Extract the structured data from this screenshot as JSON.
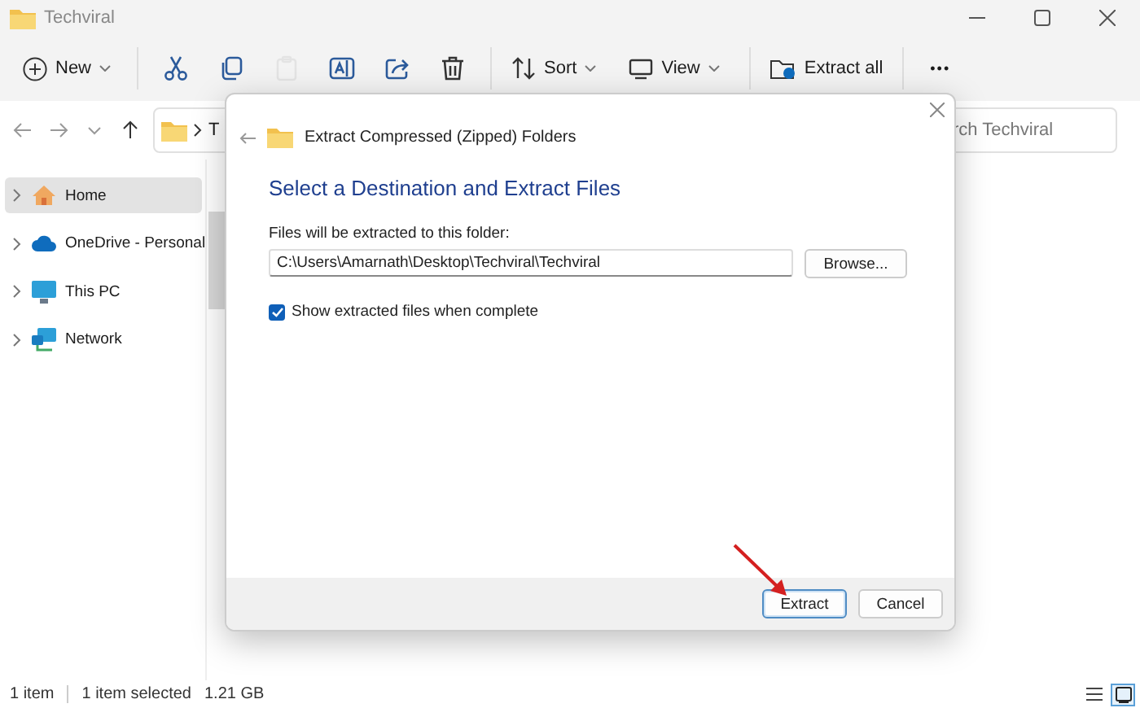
{
  "window": {
    "title": "Techviral"
  },
  "toolbar": {
    "new": "New",
    "icon_buttons": [
      {
        "kind": "cut",
        "disabled": false
      },
      {
        "kind": "copy",
        "disabled": false
      },
      {
        "kind": "paste",
        "disabled": true
      },
      {
        "kind": "rename",
        "disabled": false
      },
      {
        "kind": "share",
        "disabled": false
      },
      {
        "kind": "delete",
        "disabled": false
      }
    ],
    "sort": "Sort",
    "view": "View",
    "extract_all": "Extract all",
    "more": "•••"
  },
  "address_bar": {
    "path": "T",
    "search_placeholder": "rch Techviral"
  },
  "sidebar": {
    "items": [
      {
        "kind": "home",
        "label": "Home",
        "selected": true,
        "expanded": false
      },
      {
        "kind": "cloud",
        "label": "OneDrive - Personal",
        "selected": false,
        "expanded": false
      },
      {
        "kind": "pc",
        "label": "This PC",
        "selected": false,
        "expanded": false
      },
      {
        "kind": "network",
        "label": "Network",
        "selected": false,
        "expanded": false
      }
    ]
  },
  "dialog": {
    "title": "Extract Compressed (Zipped) Folders",
    "heading": "Select a Destination and Extract Files",
    "field_label": "Files will be extracted to this folder:",
    "path": "C:\\Users\\Amarnath\\Desktop\\Techviral\\Techviral",
    "browse": "Browse...",
    "checkbox": {
      "label": "Show extracted files when complete",
      "checked": true
    },
    "buttons": [
      {
        "label": "Extract",
        "default": true
      },
      {
        "label": "Cancel",
        "default": false
      }
    ]
  },
  "status_bar": {
    "count": "1 item",
    "selection": "1 item selected",
    "size": "1.21 GB",
    "views": [
      {
        "kind": "details",
        "selected": false
      },
      {
        "kind": "tiles",
        "selected": true
      }
    ]
  }
}
